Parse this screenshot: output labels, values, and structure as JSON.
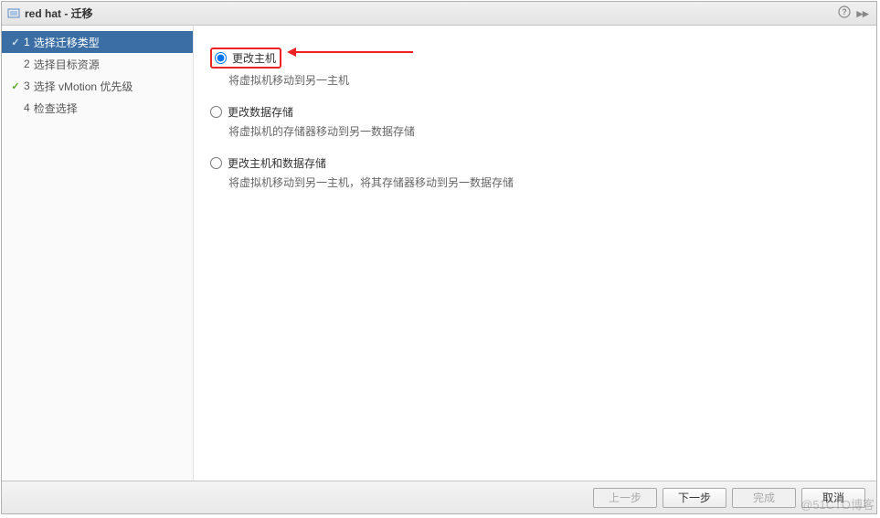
{
  "title": "red hat - 迁移",
  "sidebar": {
    "steps": [
      {
        "num": "1",
        "label": "选择迁移类型",
        "checked": true,
        "active": true
      },
      {
        "num": "2",
        "label": "选择目标资源",
        "checked": false,
        "active": false
      },
      {
        "num": "3",
        "label": "选择 vMotion 优先级",
        "checked": true,
        "active": false
      },
      {
        "num": "4",
        "label": "检查选择",
        "checked": false,
        "active": false
      }
    ]
  },
  "options": [
    {
      "label": "更改主机",
      "desc": "将虚拟机移动到另一主机",
      "selected": true,
      "highlighted": true
    },
    {
      "label": "更改数据存储",
      "desc": "将虚拟机的存储器移动到另一数据存储",
      "selected": false,
      "highlighted": false
    },
    {
      "label": "更改主机和数据存储",
      "desc": "将虚拟机移动到另一主机，将其存储器移动到另一数据存储",
      "selected": false,
      "highlighted": false
    }
  ],
  "footer": {
    "back": "上一步",
    "next": "下一步",
    "finish": "完成",
    "cancel": "取消"
  },
  "watermark": "@51CTO博客"
}
